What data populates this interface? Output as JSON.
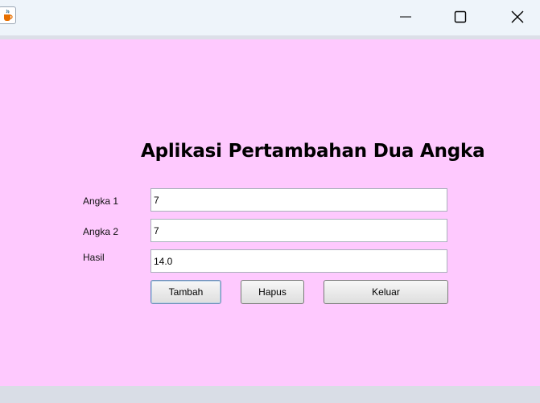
{
  "window": {
    "app_icon": "java-coffee-cup-icon",
    "controls": [
      "minimize-icon",
      "maximize-icon",
      "close-icon"
    ]
  },
  "form": {
    "title": "Aplikasi Pertambahan Dua Angka",
    "fields": [
      {
        "label": "Angka 1",
        "value": "7"
      },
      {
        "label": "Angka 2",
        "value": "7"
      },
      {
        "label": "Hasil",
        "value": "14.0"
      }
    ],
    "buttons": {
      "add": "Tambah",
      "clear": "Hapus",
      "exit": "Keluar"
    }
  },
  "colors": {
    "background": "#fec9fe",
    "titlebar": "#eef4fa"
  }
}
